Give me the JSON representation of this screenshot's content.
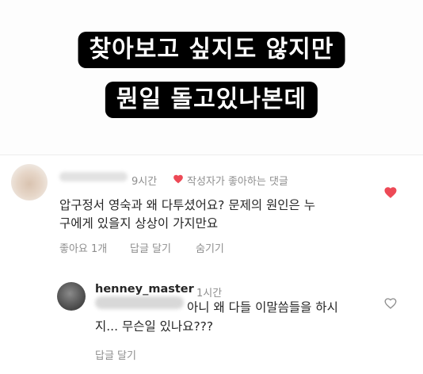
{
  "caption": {
    "line1": "찾아보고 싶지도 않지만",
    "line2": "뭔일 돌고있나본데"
  },
  "comment": {
    "time": "9시간",
    "liked_by_creator": "작성자가 좋아하는 댓글",
    "text_line1": "압구정서 영숙과 왜 다투셨어요? 문제의 원인은 누",
    "text_line2": "구에게 있을지 상상이 가지만요",
    "likes": "좋아요 1개",
    "reply_label": "답글 달기",
    "hide_label": "숨기기",
    "liked": true
  },
  "reply": {
    "username": "henney_master",
    "time": "1시간",
    "text_line1": "아니 왜 다들 이말씀들을 하시",
    "text_line2": "지... 무슨일 있나요???",
    "reply_label": "답글 달기",
    "liked": false
  },
  "colors": {
    "heart_red": "#ed4956",
    "meta_gray": "#8e8e8e",
    "caption_bg": "#000000"
  }
}
